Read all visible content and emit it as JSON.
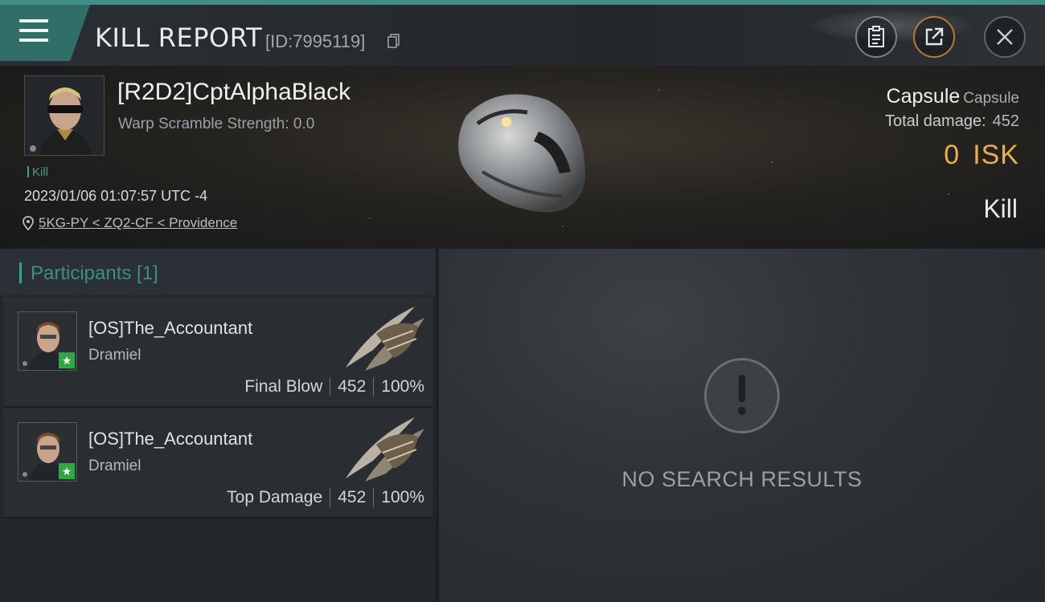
{
  "header": {
    "title": "KILL REPORT",
    "kill_id": "[ID:7995119]"
  },
  "victim": {
    "name": "[R2D2]CptAlphaBlack",
    "warp_scramble": "Warp Scramble Strength: 0.0",
    "tag": "Kill",
    "datetime": "2023/01/06 01:07:57 UTC -4",
    "location": "5KG-PY < ZQ2-CF < Providence",
    "ship_name": "Capsule",
    "ship_type": "Capsule",
    "total_damage_label": "Total damage:",
    "total_damage": "452",
    "isk_value": "0",
    "isk_unit": "ISK",
    "result": "Kill"
  },
  "participants": {
    "title": "Participants [1]",
    "rows": [
      {
        "name": "[OS]The_Accountant",
        "ship": "Dramiel",
        "role": "Final Blow",
        "damage": "452",
        "percent": "100%"
      },
      {
        "name": "[OS]The_Accountant",
        "ship": "Dramiel",
        "role": "Top Damage",
        "damage": "452",
        "percent": "100%"
      }
    ]
  },
  "results": {
    "empty_text": "NO SEARCH RESULTS"
  },
  "colors": {
    "accent": "#3f9e92",
    "isk": "#e7b04a",
    "star_badge": "#2ea845"
  }
}
